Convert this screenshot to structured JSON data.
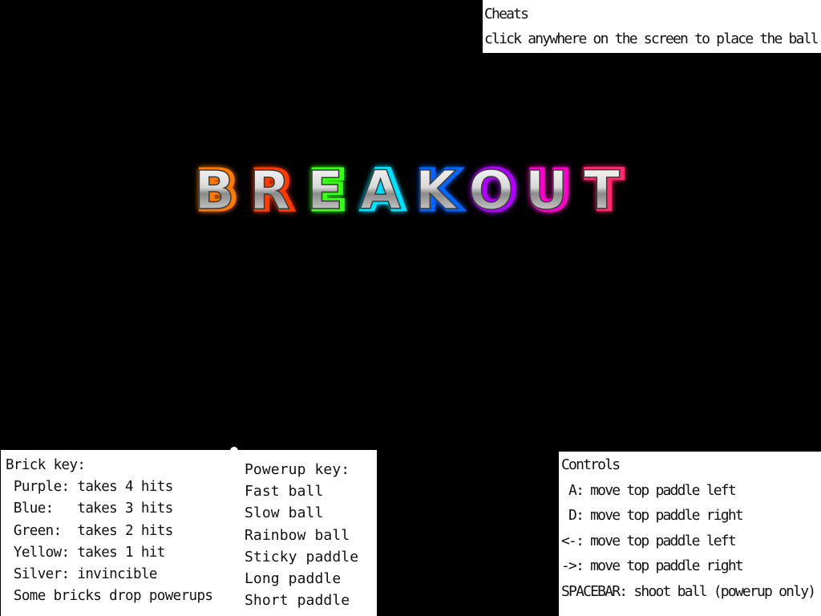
{
  "game": {
    "title": "BREAKOUT",
    "logo_colors": [
      "#ff7a00",
      "#ff3b00",
      "#39ff14",
      "#00e0ff",
      "#0066ff",
      "#b000ff",
      "#ff00cc",
      "#ff2a6d"
    ]
  },
  "cheats": {
    "heading": "Cheats",
    "lines": [
      "click anywhere on the screen to place the ball"
    ]
  },
  "brick_key": {
    "heading": "Brick key:",
    "lines": [
      " Purple: takes 4 hits",
      " Blue:   takes 3 hits",
      " Green:  takes 2 hits",
      " Yellow: takes 1 hit",
      " Silver: invincible",
      " Some bricks drop powerups"
    ]
  },
  "powerup_key": {
    "heading": "Powerup key:",
    "lines": [
      "Fast ball",
      "Slow ball",
      "Rainbow ball",
      "Sticky paddle",
      "Long paddle",
      "Short paddle"
    ]
  },
  "controls": {
    "heading": "Controls",
    "lines": [
      " A: move top paddle left",
      " D: move top paddle right",
      "<-: move top paddle left",
      "->: move top paddle right",
      "SPACEBAR: shoot ball (powerup only)"
    ]
  }
}
